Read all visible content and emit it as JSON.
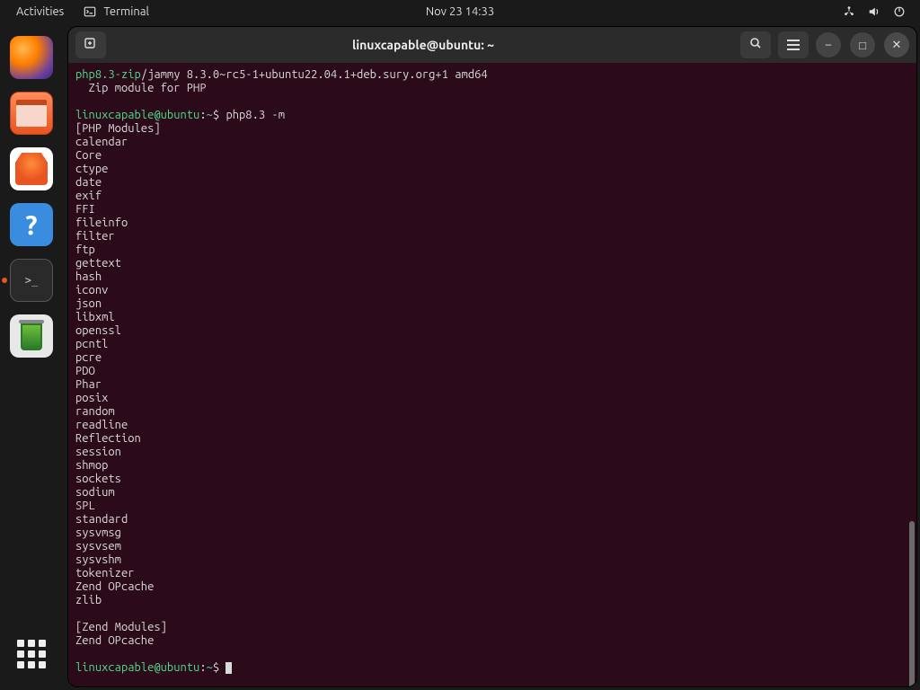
{
  "panel": {
    "activities": "Activities",
    "app_label": "Terminal",
    "clock": "Nov 23  14:33"
  },
  "dock": {
    "tooltip": "Terminal"
  },
  "window": {
    "title": "linuxcapable@ubuntu: ~"
  },
  "term": {
    "pkg_name": "php8.3-zip",
    "pkg_rest": "/jammy 8.3.0~rc5-1+ubuntu22.04.1+deb.sury.org+1 amd64",
    "pkg_desc": "  Zip module for PHP",
    "prompt_user": "linuxcapable@ubuntu",
    "prompt_sep": ":",
    "prompt_path": "~",
    "prompt_dollar": "$ ",
    "cmd1": "php8.3 -m",
    "header_php": "[PHP Modules]",
    "modules": [
      "calendar",
      "Core",
      "ctype",
      "date",
      "exif",
      "FFI",
      "fileinfo",
      "filter",
      "ftp",
      "gettext",
      "hash",
      "iconv",
      "json",
      "libxml",
      "openssl",
      "pcntl",
      "pcre",
      "PDO",
      "Phar",
      "posix",
      "random",
      "readline",
      "Reflection",
      "session",
      "shmop",
      "sockets",
      "sodium",
      "SPL",
      "standard",
      "sysvmsg",
      "sysvsem",
      "sysvshm",
      "tokenizer",
      "Zend OPcache",
      "zlib"
    ],
    "header_zend": "[Zend Modules]",
    "zend_modules": [
      "Zend OPcache"
    ]
  }
}
